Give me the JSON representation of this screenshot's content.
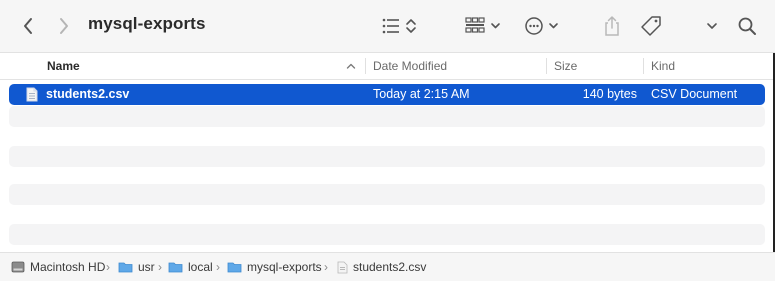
{
  "window": {
    "title": "mysql-exports"
  },
  "columns": {
    "name": "Name",
    "date": "Date Modified",
    "size": "Size",
    "kind": "Kind"
  },
  "files": [
    {
      "name": "students2.csv",
      "date": "Today at 2:15 AM",
      "size": "140 bytes",
      "kind": "CSV Document",
      "selected": true
    }
  ],
  "pathbar": {
    "items": [
      {
        "label": "Macintosh HD",
        "icon": "disk-icon"
      },
      {
        "label": "usr",
        "icon": "folder-icon"
      },
      {
        "label": "local",
        "icon": "folder-icon"
      },
      {
        "label": "mysql-exports",
        "icon": "folder-icon"
      },
      {
        "label": "students2.csv",
        "icon": "document-icon"
      }
    ],
    "separator": "›"
  },
  "colors": {
    "selection": "#1058d0",
    "folder": "#5fa8e8"
  }
}
